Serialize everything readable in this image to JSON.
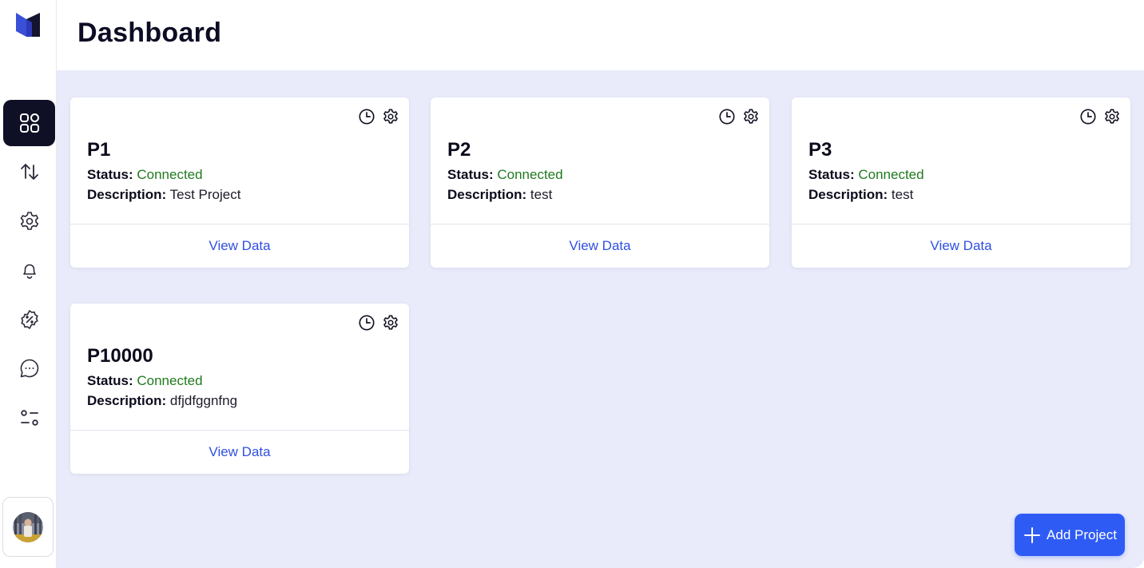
{
  "header": {
    "title": "Dashboard"
  },
  "sidebar": {
    "items": [
      {
        "name": "dashboard",
        "icon": "grid-icon",
        "active": true
      },
      {
        "name": "transfers",
        "icon": "arrows-up-down-icon",
        "active": false
      },
      {
        "name": "settings",
        "icon": "gear-icon",
        "active": false
      },
      {
        "name": "notifications",
        "icon": "bell-icon",
        "active": false
      },
      {
        "name": "discounts",
        "icon": "discount-badge-icon",
        "active": false
      },
      {
        "name": "messages",
        "icon": "chat-bubble-icon",
        "active": false
      },
      {
        "name": "preferences",
        "icon": "sliders-icon",
        "active": false
      }
    ]
  },
  "labels": {
    "status": "Status:",
    "description": "Description:",
    "view_data": "View Data"
  },
  "projects": [
    {
      "name": "P1",
      "status": "Connected",
      "description": "Test Project"
    },
    {
      "name": "P2",
      "status": "Connected",
      "description": "test"
    },
    {
      "name": "P3",
      "status": "Connected",
      "description": "test"
    },
    {
      "name": "P10000",
      "status": "Connected",
      "description": "dfjdfggnfng"
    }
  ],
  "add_button": {
    "label": "Add Project"
  },
  "colors": {
    "accent": "#2f5bf5",
    "link": "#3050e0",
    "status_connected": "#1f7a1f",
    "main_bg": "#e9ebfa",
    "nav_active": "#0f0f25"
  }
}
